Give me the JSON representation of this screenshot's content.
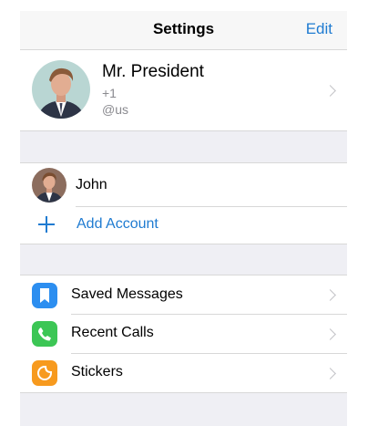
{
  "nav": {
    "title": "Settings",
    "edit_label": "Edit"
  },
  "profile": {
    "name": "Mr. President",
    "phone": "+1",
    "username": "@us"
  },
  "accounts": {
    "items": [
      {
        "label": "John"
      }
    ],
    "add_label": "Add Account"
  },
  "menu": {
    "items": [
      {
        "label": "Saved Messages",
        "icon": "bookmark-icon",
        "color": "#2c8ef0"
      },
      {
        "label": "Recent Calls",
        "icon": "phone-icon",
        "color": "#3cc655"
      },
      {
        "label": "Stickers",
        "icon": "sticker-icon",
        "color": "#f79a1e"
      }
    ]
  },
  "colors": {
    "accent": "#1f7bd1",
    "group_background": "#efeff4"
  }
}
